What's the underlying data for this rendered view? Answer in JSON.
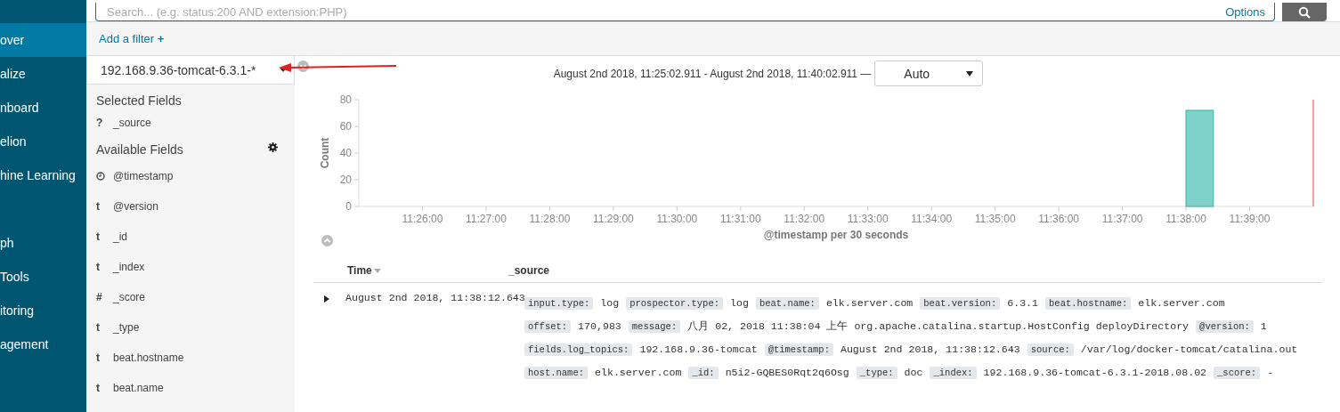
{
  "sidebar": {
    "items": [
      {
        "label": "over",
        "selected": true,
        "gap_before": false
      },
      {
        "label": "alize",
        "selected": false,
        "gap_before": false
      },
      {
        "label": "nboard",
        "selected": false,
        "gap_before": false
      },
      {
        "label": "elion",
        "selected": false,
        "gap_before": false
      },
      {
        "label": "hine Learning",
        "selected": false,
        "gap_before": false
      },
      {
        "label": "ph",
        "selected": false,
        "gap_before": true
      },
      {
        "label": "Tools",
        "selected": false,
        "gap_before": false
      },
      {
        "label": "itoring",
        "selected": false,
        "gap_before": false
      },
      {
        "label": "agement",
        "selected": false,
        "gap_before": false
      }
    ]
  },
  "query_bar": {
    "placeholder": "Search... (e.g. status:200 AND extension:PHP)",
    "options": "Options"
  },
  "filter_bar": {
    "add_filter": "Add a filter",
    "plus": "+"
  },
  "index_pattern": {
    "value": "192.168.9.36-tomcat-6.3.1-*"
  },
  "field_list": {
    "selected_title": "Selected Fields",
    "selected": [
      {
        "kind": "glyph",
        "glyph": "?",
        "name": "_source"
      }
    ],
    "available_title": "Available Fields",
    "available": [
      {
        "kind": "date",
        "name": "@timestamp"
      },
      {
        "kind": "glyph",
        "glyph": "t",
        "name": "@version"
      },
      {
        "kind": "glyph",
        "glyph": "t",
        "name": "_id"
      },
      {
        "kind": "glyph",
        "glyph": "t",
        "name": "_index"
      },
      {
        "kind": "glyph",
        "glyph": "#",
        "name": "_score"
      },
      {
        "kind": "glyph",
        "glyph": "t",
        "name": "_type"
      },
      {
        "kind": "glyph",
        "glyph": "t",
        "name": "beat.hostname"
      },
      {
        "kind": "glyph",
        "glyph": "t",
        "name": "beat.name"
      }
    ]
  },
  "time_range": {
    "text": "August 2nd 2018, 11:25:02.911 - August 2nd 2018, 11:40:02.911 —",
    "interval": "Auto"
  },
  "histogram": {
    "chart_data": {
      "type": "bar",
      "xlabel": "@timestamp per 30 seconds",
      "ylabel": "Count",
      "categories": [
        null,
        null,
        "11:26:00",
        null,
        "11:27:00",
        null,
        "11:28:00",
        null,
        "11:29:00",
        null,
        "11:30:00",
        null,
        "11:31:00",
        null,
        "11:32:00",
        null,
        "11:33:00",
        null,
        "11:34:00",
        null,
        "11:35:00",
        null,
        "11:36:00",
        null,
        "11:37:00",
        null,
        "11:38:00",
        null,
        "11:39:00",
        null
      ],
      "series": [
        {
          "color": "#7fd1ca",
          "values": [
            0,
            0,
            0,
            0,
            0,
            0,
            0,
            0,
            0,
            0,
            0,
            0,
            0,
            0,
            0,
            0,
            0,
            0,
            0,
            0,
            0,
            0,
            0,
            0,
            0,
            0,
            72,
            0,
            0,
            0
          ]
        }
      ],
      "ylim": [
        0,
        80
      ],
      "yticks": [
        0,
        20,
        40,
        60,
        80
      ]
    }
  },
  "table": {
    "columns": [
      {
        "label": "Time",
        "sort_caret": true
      },
      {
        "label": "_source",
        "sort_caret": false
      }
    ],
    "rows": [
      {
        "expanded": false,
        "time": "August 2nd 2018, 11:38:12.643",
        "source": [
          {
            "key": "input.type:",
            "value": "log"
          },
          {
            "key": "prospector.type:",
            "value": "log"
          },
          {
            "key": "beat.name:",
            "value": "elk.server.com"
          },
          {
            "key": "beat.version:",
            "value": "6.3.1"
          },
          {
            "key": "beat.hostname:",
            "value": "elk.server.com"
          },
          {
            "key": "offset:",
            "value": "170,983"
          },
          {
            "key": "message:",
            "value": "八月 02, 2018 11:38:04 上午 org.apache.catalina.startup.HostConfig deployDirectory"
          },
          {
            "key": "@version:",
            "value": "1"
          },
          {
            "key": "fields.log_topics:",
            "value": "192.168.9.36-tomcat"
          },
          {
            "key": "@timestamp:",
            "value": "August 2nd 2018, 11:38:12.643"
          },
          {
            "key": "source:",
            "value": "/var/log/docker-tomcat/catalina.out"
          },
          {
            "key": "host.name:",
            "value": "elk.server.com"
          },
          {
            "key": "_id:",
            "value": "n5i2-GQBES0Rqt2q6Osg"
          },
          {
            "key": "_type:",
            "value": "doc"
          },
          {
            "key": "_index:",
            "value": "192.168.9.36-tomcat-6.3.1-2018.08.02"
          },
          {
            "key": "_score:",
            "value": "-"
          }
        ]
      }
    ]
  }
}
